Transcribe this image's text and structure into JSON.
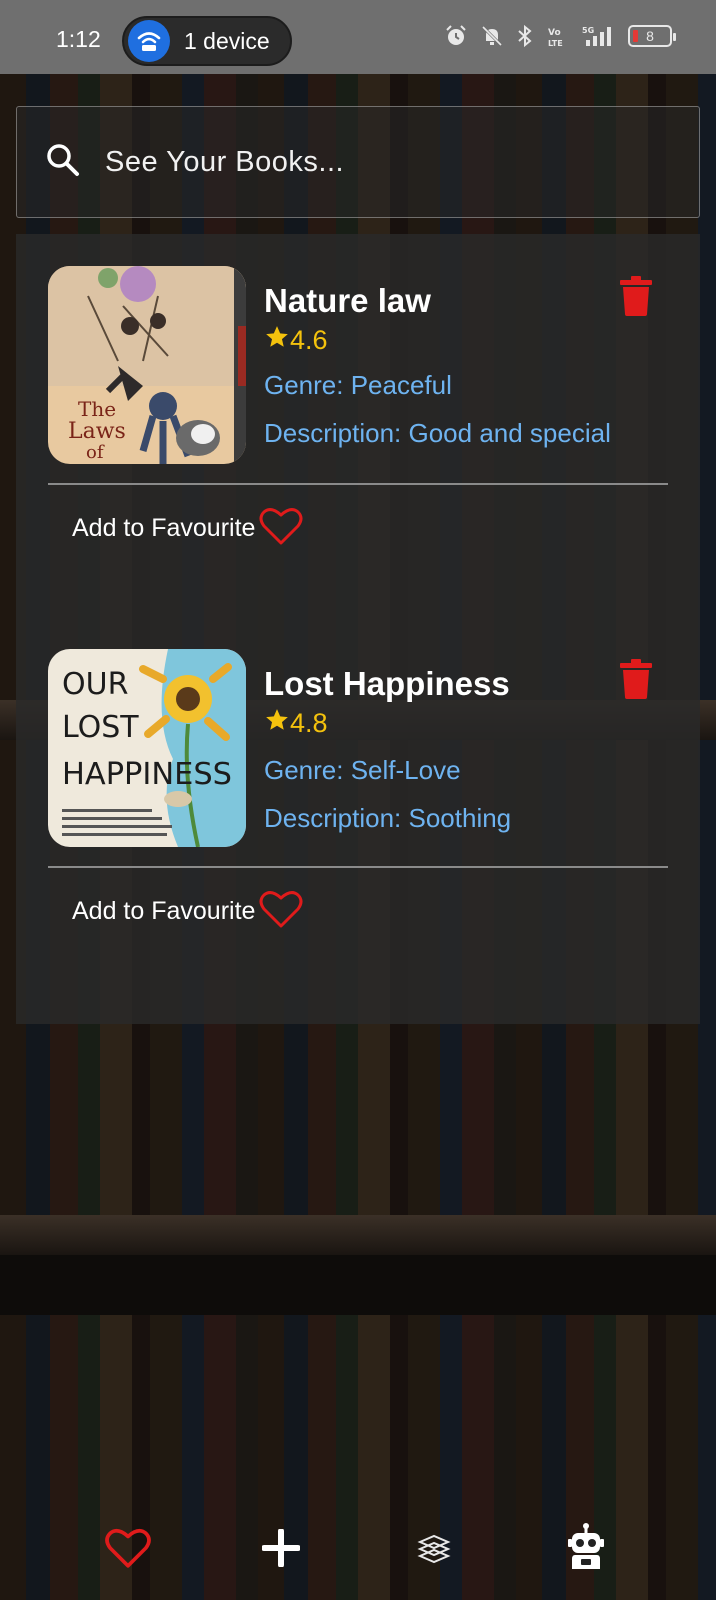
{
  "status_bar": {
    "time": "1:12",
    "device_count": "1 device",
    "battery_level": "8"
  },
  "search": {
    "placeholder": "See Your Books..."
  },
  "books": [
    {
      "title": "Nature law",
      "rating": "4.6",
      "genre": "Genre: Peaceful",
      "description": "Description: Good and special",
      "favourite_label": "Add to Favourite",
      "cover_text": [
        "The",
        "Laws",
        "of"
      ]
    },
    {
      "title": "Lost Happiness",
      "rating": "4.8",
      "genre": "Genre: Self-Love",
      "description": "Description: Soothing",
      "favourite_label": "Add to Favourite",
      "cover_text": [
        "OUR",
        "LOST",
        "HAPPINESS"
      ]
    }
  ],
  "bottom_nav": {
    "items": [
      "heart-icon",
      "plus-icon",
      "books-icon",
      "robot-icon"
    ]
  },
  "colors": {
    "accent_red": "#e53935",
    "rating_yellow": "#f4c20d",
    "link_blue": "#6eb3f0",
    "panel": "#2a2a2a"
  }
}
